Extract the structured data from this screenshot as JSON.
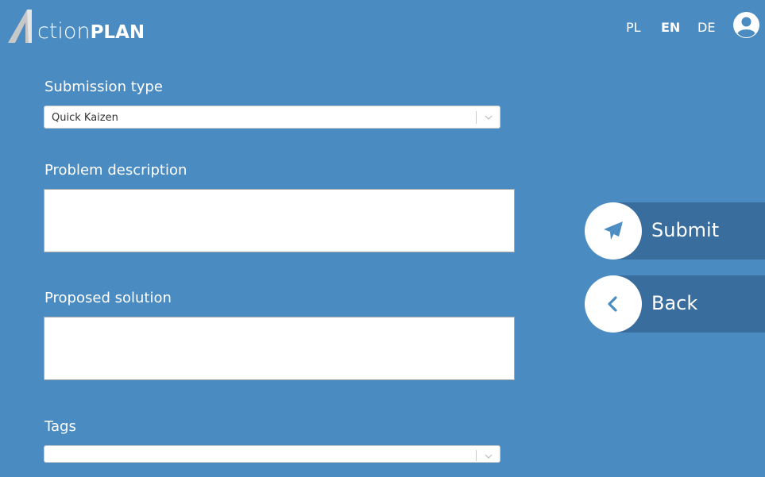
{
  "header": {
    "logo": {
      "part1": "ction",
      "part2": "PLAN"
    },
    "languages": [
      {
        "code": "PL",
        "active": false
      },
      {
        "code": "EN",
        "active": true
      },
      {
        "code": "DE",
        "active": false
      }
    ],
    "user_icon": "user-circle-icon"
  },
  "form": {
    "submission_type": {
      "label": "Submission type",
      "value": "Quick Kaizen"
    },
    "problem_description": {
      "label": "Problem description",
      "value": ""
    },
    "proposed_solution": {
      "label": "Proposed solution",
      "value": ""
    },
    "tags": {
      "label": "Tags",
      "value": ""
    }
  },
  "actions": {
    "submit": {
      "label": "Submit",
      "icon": "paper-plane-icon"
    },
    "back": {
      "label": "Back",
      "icon": "chevron-left-icon"
    }
  },
  "colors": {
    "background": "#4a8bc2",
    "action_bar": "#386d9d",
    "icon": "#4a8bc2",
    "logo_a": "#c4c4c4"
  }
}
